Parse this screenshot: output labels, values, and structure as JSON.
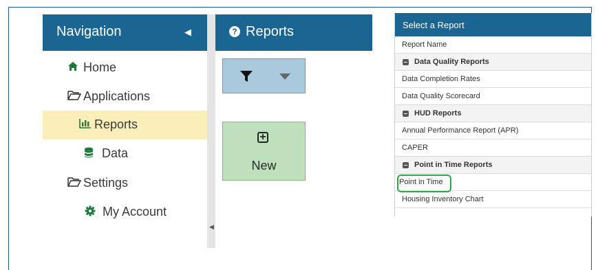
{
  "navigation": {
    "title": "Navigation",
    "items": [
      {
        "label": "Home",
        "icon": "home-icon"
      },
      {
        "label": "Applications",
        "icon": "folder-open-icon"
      },
      {
        "label": "Reports",
        "icon": "bar-chart-icon",
        "active": true
      },
      {
        "label": "Data",
        "icon": "database-icon"
      },
      {
        "label": "Settings",
        "icon": "folder-open-icon"
      },
      {
        "label": "My Account",
        "icon": "gear-icon"
      }
    ]
  },
  "reports": {
    "title": "Reports",
    "new_label": "New"
  },
  "select_report": {
    "title": "Select a Report",
    "column_header": "Report Name",
    "rows": [
      {
        "type": "group",
        "label": "Data Quality Reports"
      },
      {
        "type": "item",
        "label": "Data Completion Rates"
      },
      {
        "type": "item",
        "label": "Data Quality Scorecard"
      },
      {
        "type": "group",
        "label": "HUD Reports"
      },
      {
        "type": "item",
        "label": "Annual Performance Report (APR)"
      },
      {
        "type": "item",
        "label": "CAPER"
      },
      {
        "type": "group",
        "label": "Point in Time Reports"
      },
      {
        "type": "item",
        "label": "Point in Time"
      },
      {
        "type": "item",
        "label": "Housing Inventory Chart"
      }
    ]
  },
  "colors": {
    "header_blue": "#1a6591",
    "active_highlight": "#fbeeb8",
    "filter_button": "#a9c9dc",
    "new_button": "#bfe0bc",
    "callout_green": "#2aa84a"
  }
}
